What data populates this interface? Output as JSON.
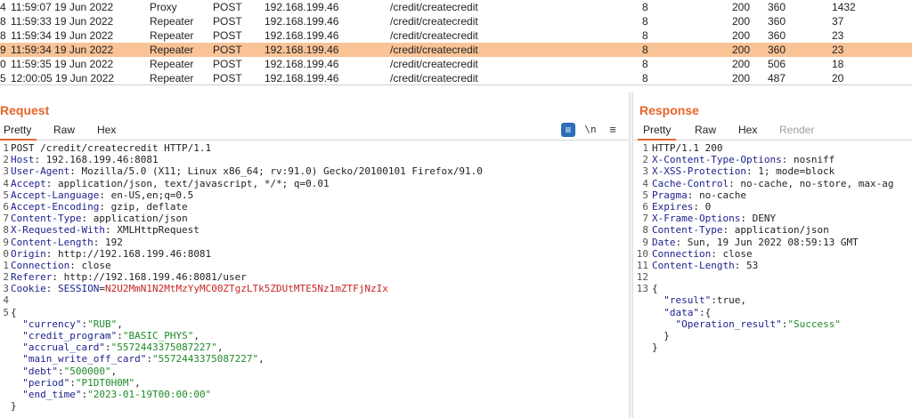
{
  "history": [
    {
      "num": "4",
      "time": "11:59:07 19 Jun 2022",
      "tool": "Proxy",
      "method": "POST",
      "host": "192.168.199.46",
      "url": "/credit/createcredit",
      "params": "8",
      "status": "200",
      "length": "360",
      "mime": "1432",
      "selected": false
    },
    {
      "num": "8",
      "time": "11:59:33 19 Jun 2022",
      "tool": "Repeater",
      "method": "POST",
      "host": "192.168.199.46",
      "url": "/credit/createcredit",
      "params": "8",
      "status": "200",
      "length": "360",
      "mime": "37",
      "selected": false
    },
    {
      "num": "8",
      "time": "11:59:34 19 Jun 2022",
      "tool": "Repeater",
      "method": "POST",
      "host": "192.168.199.46",
      "url": "/credit/createcredit",
      "params": "8",
      "status": "200",
      "length": "360",
      "mime": "23",
      "selected": false
    },
    {
      "num": "9",
      "time": "11:59:34 19 Jun 2022",
      "tool": "Repeater",
      "method": "POST",
      "host": "192.168.199.46",
      "url": "/credit/createcredit",
      "params": "8",
      "status": "200",
      "length": "360",
      "mime": "23",
      "selected": true
    },
    {
      "num": "0",
      "time": "11:59:35 19 Jun 2022",
      "tool": "Repeater",
      "method": "POST",
      "host": "192.168.199.46",
      "url": "/credit/createcredit",
      "params": "8",
      "status": "200",
      "length": "506",
      "mime": "18",
      "selected": false
    },
    {
      "num": "5",
      "time": "12:00:05 19 Jun 2022",
      "tool": "Repeater",
      "method": "POST",
      "host": "192.168.199.46",
      "url": "/credit/createcredit",
      "params": "8",
      "status": "200",
      "length": "487",
      "mime": "20",
      "selected": false
    }
  ],
  "request": {
    "title": "Request",
    "tabs": [
      "Pretty",
      "Raw",
      "Hex"
    ],
    "icons": {
      "wrap": "≡",
      "newline": "\\n",
      "menu": "≡"
    },
    "lines": [
      {
        "n": "1",
        "parts": [
          {
            "t": "POST /credit/createcredit HTTP/1.1",
            "c": "punct"
          }
        ]
      },
      {
        "n": "2",
        "parts": [
          {
            "t": "Host",
            "c": "hname"
          },
          {
            "t": ": 192.168.199.46:8081",
            "c": "punct"
          }
        ]
      },
      {
        "n": "3",
        "parts": [
          {
            "t": "User-Agent",
            "c": "hname"
          },
          {
            "t": ": Mozilla/5.0 (X11; Linux x86_64; rv:91.0) Gecko/20100101 Firefox/91.0",
            "c": "punct"
          }
        ]
      },
      {
        "n": "4",
        "parts": [
          {
            "t": "Accept",
            "c": "hname"
          },
          {
            "t": ": application/json, text/javascript, */*; q=0.01",
            "c": "punct"
          }
        ]
      },
      {
        "n": "5",
        "parts": [
          {
            "t": "Accept-Language",
            "c": "hname"
          },
          {
            "t": ": en-US,en;q=0.5",
            "c": "punct"
          }
        ]
      },
      {
        "n": "6",
        "parts": [
          {
            "t": "Accept-Encoding",
            "c": "hname"
          },
          {
            "t": ": gzip, deflate",
            "c": "punct"
          }
        ]
      },
      {
        "n": "7",
        "parts": [
          {
            "t": "Content-Type",
            "c": "hname"
          },
          {
            "t": ": application/json",
            "c": "punct"
          }
        ]
      },
      {
        "n": "8",
        "parts": [
          {
            "t": "X-Requested-With",
            "c": "hname"
          },
          {
            "t": ": XMLHttpRequest",
            "c": "punct"
          }
        ]
      },
      {
        "n": "9",
        "parts": [
          {
            "t": "Content-Length",
            "c": "hname"
          },
          {
            "t": ": 192",
            "c": "punct"
          }
        ]
      },
      {
        "n": "0",
        "parts": [
          {
            "t": "Origin",
            "c": "hname"
          },
          {
            "t": ": http://192.168.199.46:8081",
            "c": "punct"
          }
        ]
      },
      {
        "n": "1",
        "parts": [
          {
            "t": "Connection",
            "c": "hname"
          },
          {
            "t": ": close",
            "c": "punct"
          }
        ]
      },
      {
        "n": "2",
        "parts": [
          {
            "t": "Referer",
            "c": "hname"
          },
          {
            "t": ": http://192.168.199.46:8081/user",
            "c": "punct"
          }
        ]
      },
      {
        "n": "3",
        "parts": [
          {
            "t": "Cookie",
            "c": "hname"
          },
          {
            "t": ": ",
            "c": "punct"
          },
          {
            "t": "SESSION",
            "c": "hname"
          },
          {
            "t": "=",
            "c": "punct"
          },
          {
            "t": "N2U2MmN1N2MtMzYyMC00ZTgzLTk5ZDUtMTE5Nz1mZTFjNzIx",
            "c": "cookie-val"
          }
        ]
      },
      {
        "n": "4",
        "parts": [
          {
            "t": "",
            "c": "punct"
          }
        ]
      },
      {
        "n": "5",
        "parts": [
          {
            "t": "{",
            "c": "punct"
          }
        ]
      },
      {
        "n": "",
        "parts": [
          {
            "t": "  ",
            "c": "punct"
          },
          {
            "t": "\"currency\"",
            "c": "jkey"
          },
          {
            "t": ":",
            "c": "punct"
          },
          {
            "t": "\"RUB\"",
            "c": "jstr"
          },
          {
            "t": ",",
            "c": "punct"
          }
        ]
      },
      {
        "n": "",
        "parts": [
          {
            "t": "  ",
            "c": "punct"
          },
          {
            "t": "\"credit_program\"",
            "c": "jkey"
          },
          {
            "t": ":",
            "c": "punct"
          },
          {
            "t": "\"BASIC_PHYS\"",
            "c": "jstr"
          },
          {
            "t": ",",
            "c": "punct"
          }
        ]
      },
      {
        "n": "",
        "parts": [
          {
            "t": "  ",
            "c": "punct"
          },
          {
            "t": "\"accrual_card\"",
            "c": "jkey"
          },
          {
            "t": ":",
            "c": "punct"
          },
          {
            "t": "\"5572443375087227\"",
            "c": "jstr"
          },
          {
            "t": ",",
            "c": "punct"
          }
        ]
      },
      {
        "n": "",
        "parts": [
          {
            "t": "  ",
            "c": "punct"
          },
          {
            "t": "\"main_write_off_card\"",
            "c": "jkey"
          },
          {
            "t": ":",
            "c": "punct"
          },
          {
            "t": "\"5572443375087227\"",
            "c": "jstr"
          },
          {
            "t": ",",
            "c": "punct"
          }
        ]
      },
      {
        "n": "",
        "parts": [
          {
            "t": "  ",
            "c": "punct"
          },
          {
            "t": "\"debt\"",
            "c": "jkey"
          },
          {
            "t": ":",
            "c": "punct"
          },
          {
            "t": "\"500000\"",
            "c": "jstr"
          },
          {
            "t": ",",
            "c": "punct"
          }
        ]
      },
      {
        "n": "",
        "parts": [
          {
            "t": "  ",
            "c": "punct"
          },
          {
            "t": "\"period\"",
            "c": "jkey"
          },
          {
            "t": ":",
            "c": "punct"
          },
          {
            "t": "\"P1DT0H0M\"",
            "c": "jstr"
          },
          {
            "t": ",",
            "c": "punct"
          }
        ]
      },
      {
        "n": "",
        "parts": [
          {
            "t": "  ",
            "c": "punct"
          },
          {
            "t": "\"end_time\"",
            "c": "jkey"
          },
          {
            "t": ":",
            "c": "punct"
          },
          {
            "t": "\"2023-01-19T00:00:00\"",
            "c": "jstr"
          }
        ]
      },
      {
        "n": "",
        "parts": [
          {
            "t": "}",
            "c": "punct"
          }
        ]
      }
    ]
  },
  "response": {
    "title": "Response",
    "tabs": [
      "Pretty",
      "Raw",
      "Hex",
      "Render"
    ],
    "lines": [
      {
        "n": "1",
        "parts": [
          {
            "t": "HTTP/1.1 200",
            "c": "punct"
          }
        ]
      },
      {
        "n": "2",
        "parts": [
          {
            "t": "X-Content-Type-Options",
            "c": "hname"
          },
          {
            "t": ": nosniff",
            "c": "punct"
          }
        ]
      },
      {
        "n": "3",
        "parts": [
          {
            "t": "X-XSS-Protection",
            "c": "hname"
          },
          {
            "t": ": 1; mode=block",
            "c": "punct"
          }
        ]
      },
      {
        "n": "4",
        "parts": [
          {
            "t": "Cache-Control",
            "c": "hname"
          },
          {
            "t": ": no-cache, no-store, max-ag",
            "c": "punct"
          }
        ]
      },
      {
        "n": "5",
        "parts": [
          {
            "t": "Pragma",
            "c": "hname"
          },
          {
            "t": ": no-cache",
            "c": "punct"
          }
        ]
      },
      {
        "n": "6",
        "parts": [
          {
            "t": "Expires",
            "c": "hname"
          },
          {
            "t": ": 0",
            "c": "punct"
          }
        ]
      },
      {
        "n": "7",
        "parts": [
          {
            "t": "X-Frame-Options",
            "c": "hname"
          },
          {
            "t": ": DENY",
            "c": "punct"
          }
        ]
      },
      {
        "n": "8",
        "parts": [
          {
            "t": "Content-Type",
            "c": "hname"
          },
          {
            "t": ": application/json",
            "c": "punct"
          }
        ]
      },
      {
        "n": "9",
        "parts": [
          {
            "t": "Date",
            "c": "hname"
          },
          {
            "t": ": Sun, 19 Jun 2022 08:59:13 GMT",
            "c": "punct"
          }
        ]
      },
      {
        "n": "10",
        "parts": [
          {
            "t": "Connection",
            "c": "hname"
          },
          {
            "t": ": close",
            "c": "punct"
          }
        ]
      },
      {
        "n": "11",
        "parts": [
          {
            "t": "Content-Length",
            "c": "hname"
          },
          {
            "t": ": 53",
            "c": "punct"
          }
        ]
      },
      {
        "n": "12",
        "parts": [
          {
            "t": "",
            "c": "punct"
          }
        ]
      },
      {
        "n": "13",
        "parts": [
          {
            "t": "{",
            "c": "punct"
          }
        ]
      },
      {
        "n": "",
        "parts": [
          {
            "t": "  ",
            "c": "punct"
          },
          {
            "t": "\"result\"",
            "c": "jkey"
          },
          {
            "t": ":true,",
            "c": "punct"
          }
        ]
      },
      {
        "n": "",
        "parts": [
          {
            "t": "  ",
            "c": "punct"
          },
          {
            "t": "\"data\"",
            "c": "jkey"
          },
          {
            "t": ":{",
            "c": "punct"
          }
        ]
      },
      {
        "n": "",
        "parts": [
          {
            "t": "    ",
            "c": "punct"
          },
          {
            "t": "\"Operation_result\"",
            "c": "jkey"
          },
          {
            "t": ":",
            "c": "punct"
          },
          {
            "t": "\"Success\"",
            "c": "jstr"
          }
        ]
      },
      {
        "n": "",
        "parts": [
          {
            "t": "  }",
            "c": "punct"
          }
        ]
      },
      {
        "n": "",
        "parts": [
          {
            "t": "}",
            "c": "punct"
          }
        ]
      }
    ]
  }
}
